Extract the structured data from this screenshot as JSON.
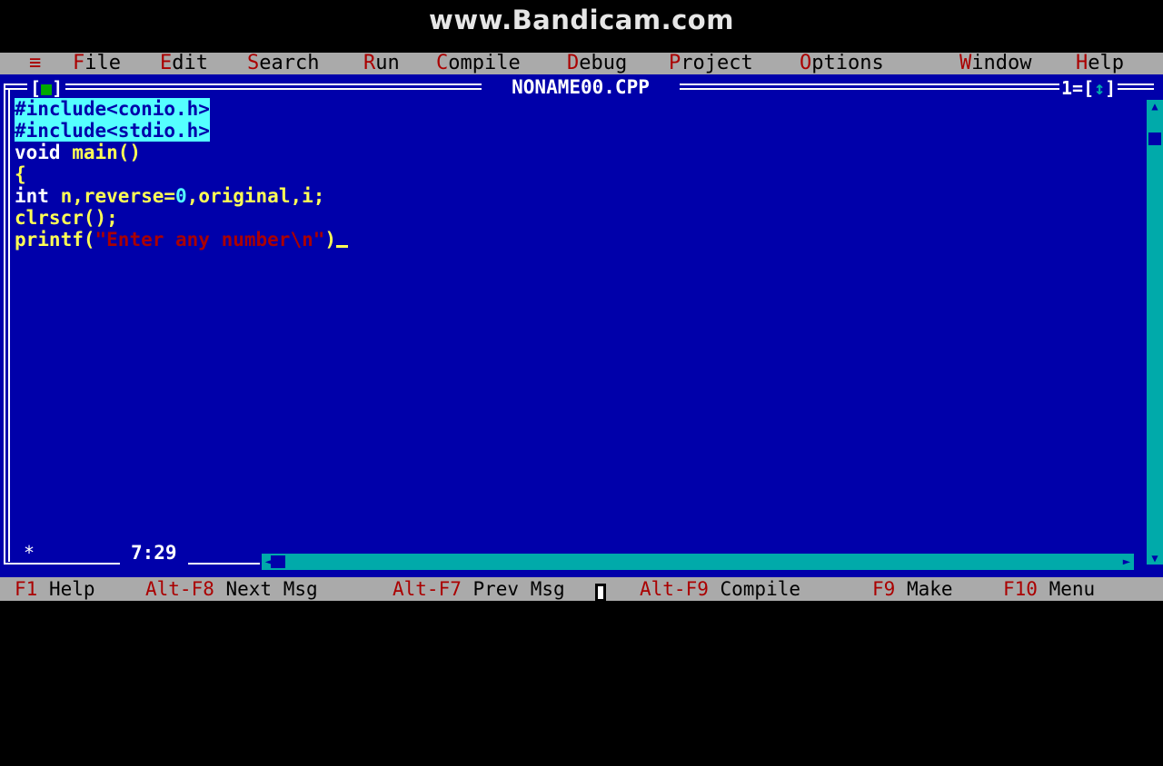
{
  "watermark": "www.Bandicam.com",
  "menubar": {
    "system": "≡",
    "items": [
      {
        "hot": "F",
        "rest": "ile"
      },
      {
        "hot": "E",
        "rest": "dit"
      },
      {
        "hot": "S",
        "rest": "earch"
      },
      {
        "hot": "R",
        "rest": "un"
      },
      {
        "hot": "C",
        "rest": "ompile"
      },
      {
        "hot": "D",
        "rest": "ebug"
      },
      {
        "hot": "P",
        "rest": "roject"
      },
      {
        "hot": "O",
        "rest": "ptions"
      },
      {
        "hot": "W",
        "rest": "indow"
      },
      {
        "hot": "H",
        "rest": "elp"
      }
    ]
  },
  "editor": {
    "close_left": "[",
    "close_mark": "■",
    "close_right": "]",
    "title": "NONAME00.CPP",
    "window_number": "1=[",
    "zoom_mark": "↕",
    "window_number_end": "]",
    "cursor_position": "7:29",
    "status_star": "*",
    "code": {
      "l1": "#include<conio.h>",
      "l2": "#include<stdio.h>",
      "l3_kw": "void",
      "l3_rest": " main()",
      "l4": "{",
      "l5_kw": "int",
      "l5_a": " n,reverse=",
      "l5_num": "0",
      "l5_b": ",original,i;",
      "l6": "clrscr();",
      "l7_fn": "printf(",
      "l7_str": "\"Enter any number\\n\"",
      "l7_end": ")"
    }
  },
  "fkeys": [
    {
      "key": "F1",
      "label": " Help"
    },
    {
      "key": "Alt-F8",
      "label": " Next Msg"
    },
    {
      "key": "Alt-F7",
      "label": " Prev Msg"
    },
    {
      "key": "Alt-F9",
      "label": " Compile"
    },
    {
      "key": "F9",
      "label": " Make"
    },
    {
      "key": "F10",
      "label": " Menu"
    }
  ],
  "colors": {
    "editor_bg": "#0000aa",
    "menu_bg": "#aaaaaa",
    "hotkey": "#aa0000",
    "selection": "#55ffff"
  }
}
